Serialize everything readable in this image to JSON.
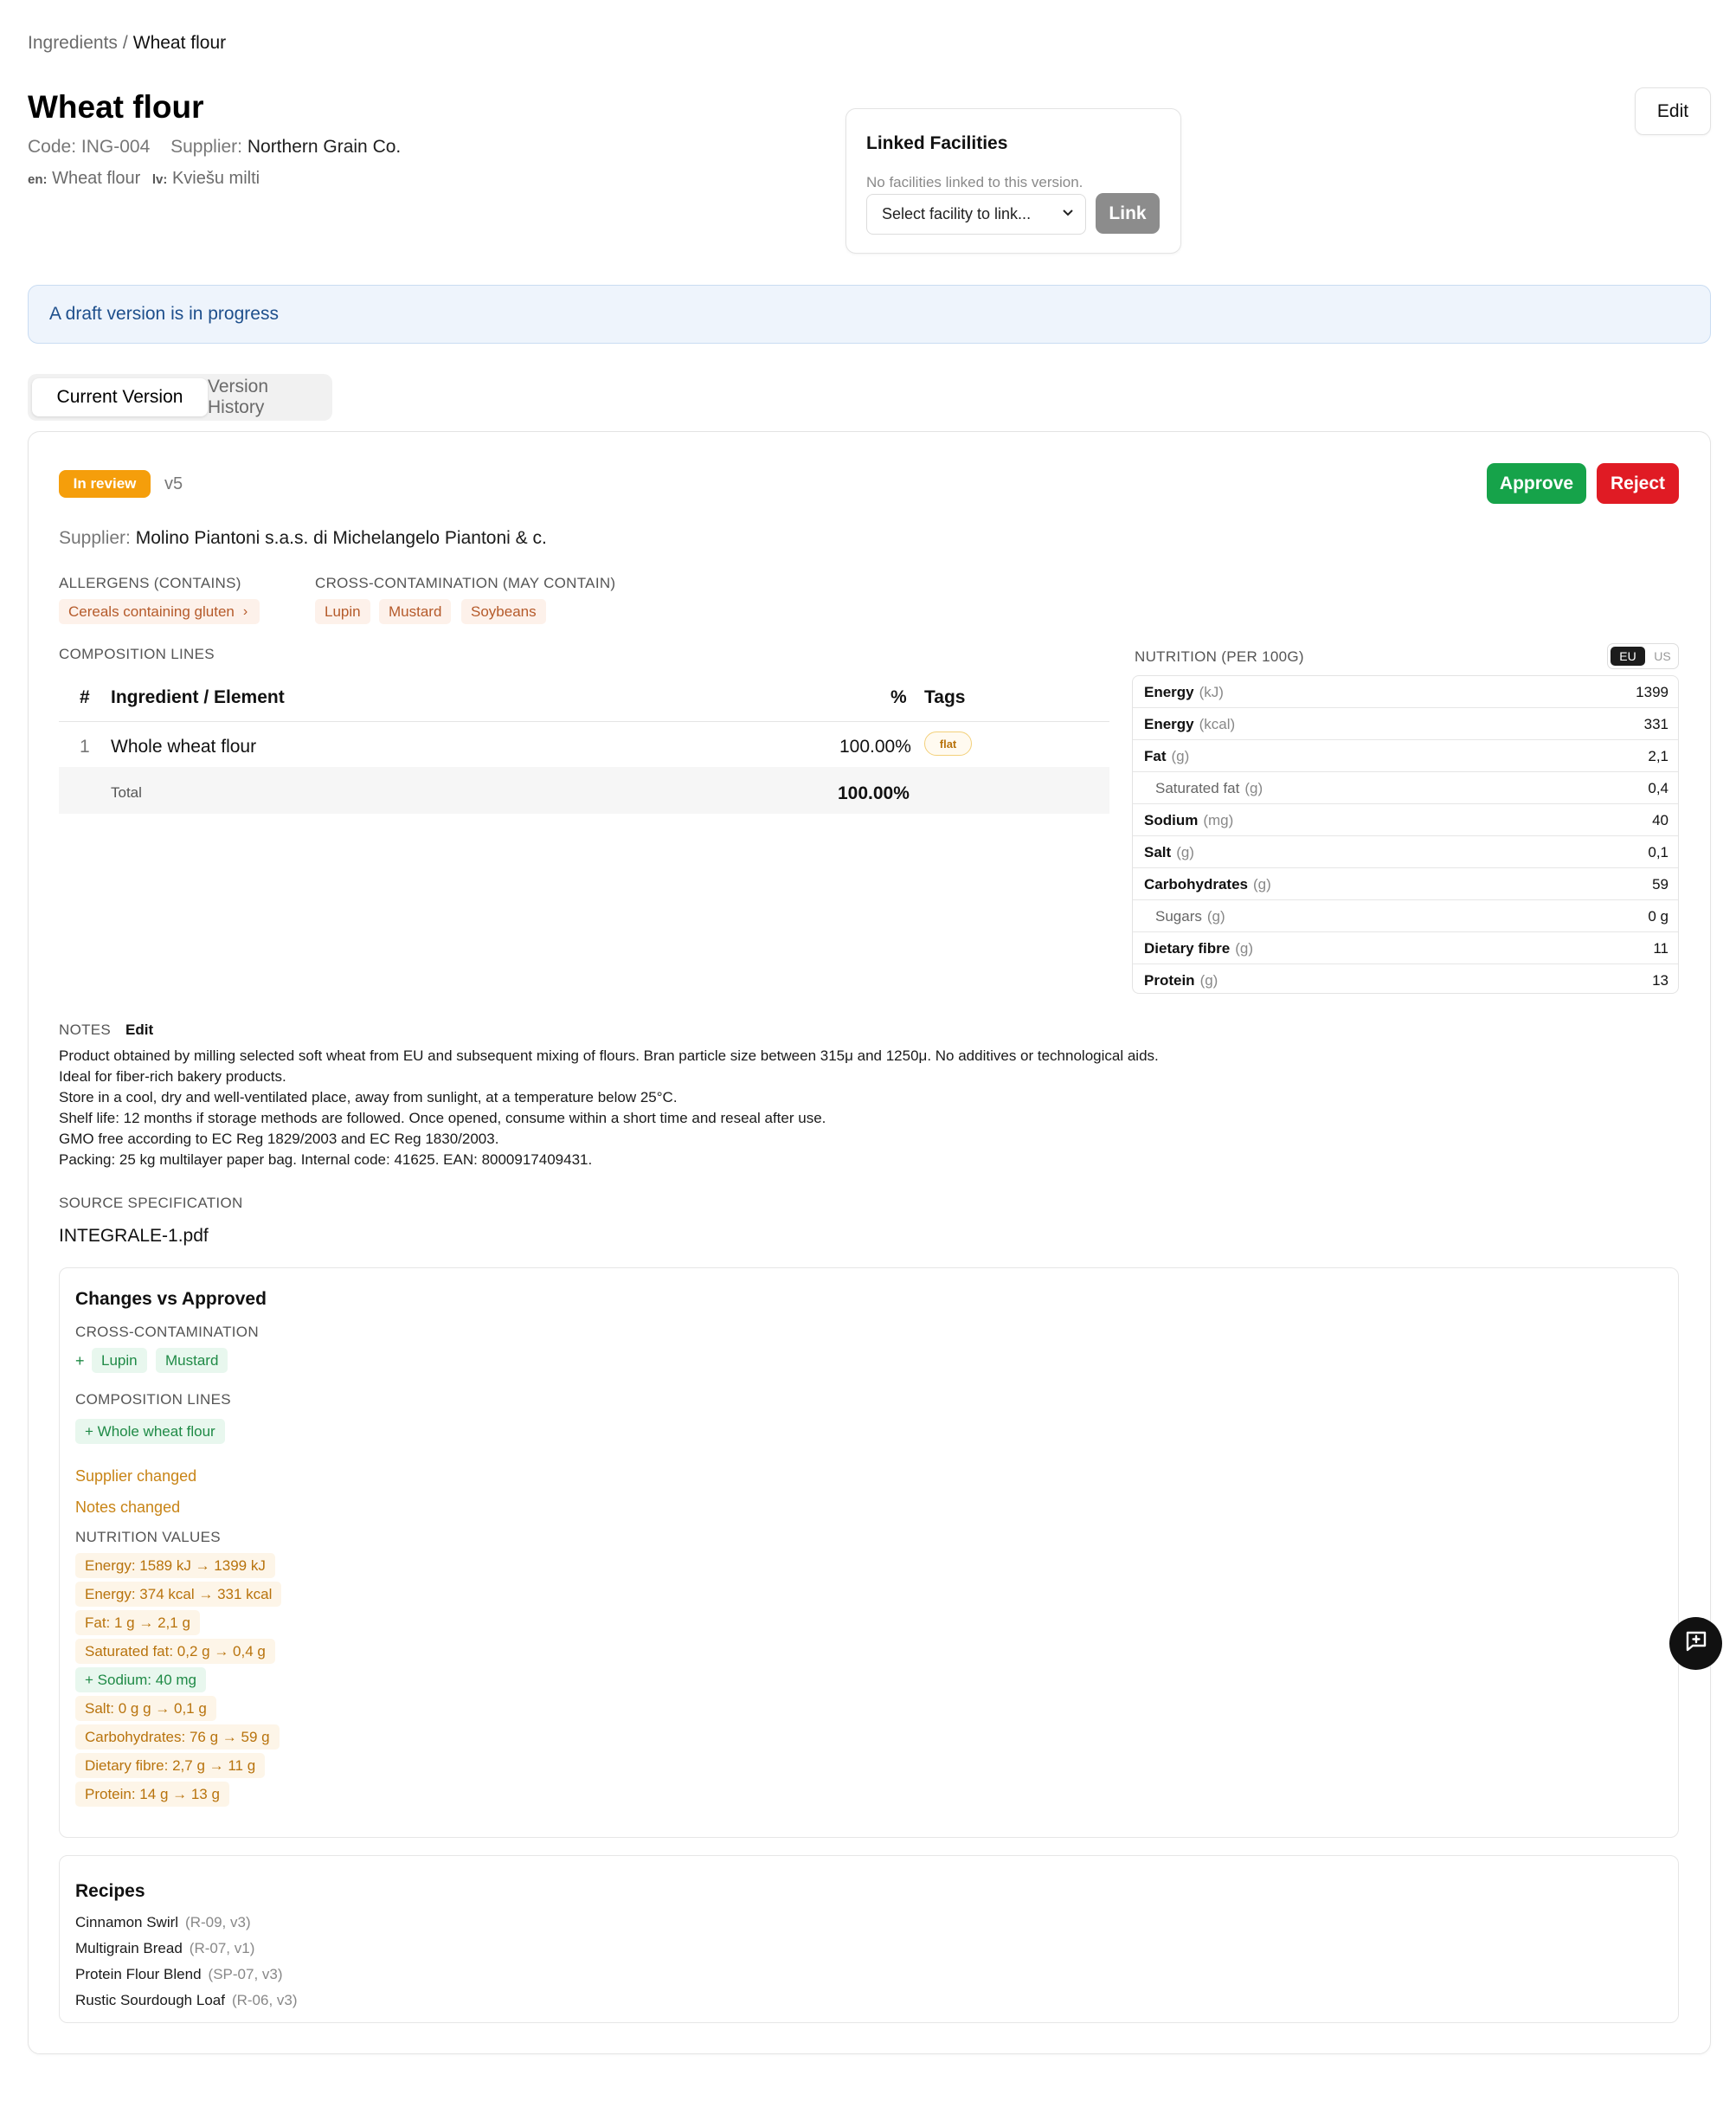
{
  "breadcrumb": {
    "root": "Ingredients",
    "separator": "/",
    "current": "Wheat flour"
  },
  "header": {
    "title": "Wheat flour",
    "code_label": "Code:",
    "code": "ING-004",
    "supplier_label": "Supplier:",
    "supplier": "Northern Grain Co.",
    "translations": [
      {
        "lang": "en:",
        "text": "Wheat flour"
      },
      {
        "lang": "lv:",
        "text": "Kviešu milti"
      }
    ],
    "edit_label": "Edit"
  },
  "facilities": {
    "title": "Linked Facilities",
    "empty_text": "No facilities linked to this version.",
    "select_placeholder": "Select facility to link...",
    "link_label": "Link"
  },
  "draft_banner": "A draft version is in progress",
  "tabs": [
    {
      "label": "Current Version"
    },
    {
      "label": "Version History"
    }
  ],
  "version": {
    "status": "In review",
    "number": "v5",
    "approve_label": "Approve",
    "reject_label": "Reject",
    "supplier_label": "Supplier:",
    "supplier": "Molino Piantoni s.a.s. di Michelangelo Piantoni & c.",
    "allergens_label": "ALLERGENS (CONTAINS)",
    "allergens": [
      "Cereals containing gluten"
    ],
    "cross_label": "CROSS-CONTAMINATION (MAY CONTAIN)",
    "cross": [
      "Lupin",
      "Mustard",
      "Soybeans"
    ]
  },
  "composition": {
    "label": "COMPOSITION LINES",
    "headers": {
      "num": "#",
      "ingredient": "Ingredient / Element",
      "pct": "%",
      "tags": "Tags"
    },
    "rows": [
      {
        "num": "1",
        "ingredient": "Whole wheat flour",
        "pct": "100.00%",
        "tag": "flat"
      }
    ],
    "total_label": "Total",
    "total_value": "100.00%"
  },
  "nutrition": {
    "label": "NUTRITION (PER 100G)",
    "toggle": {
      "eu": "EU",
      "us": "US",
      "selected": "EU"
    },
    "rows": [
      {
        "name": "Energy",
        "unit": "(kJ)",
        "value": "1399",
        "sub": false
      },
      {
        "name": "Energy",
        "unit": "(kcal)",
        "value": "331",
        "sub": false
      },
      {
        "name": "Fat",
        "unit": "(g)",
        "value": "2,1",
        "sub": false
      },
      {
        "name": "Saturated fat",
        "unit": "(g)",
        "value": "0,4",
        "sub": true
      },
      {
        "name": "Sodium",
        "unit": "(mg)",
        "value": "40",
        "sub": false
      },
      {
        "name": "Salt",
        "unit": "(g)",
        "value": "0,1",
        "sub": false
      },
      {
        "name": "Carbohydrates",
        "unit": "(g)",
        "value": "59",
        "sub": false
      },
      {
        "name": "Sugars",
        "unit": "(g)",
        "value": "0 g",
        "sub": true
      },
      {
        "name": "Dietary fibre",
        "unit": "(g)",
        "value": "11",
        "sub": false
      },
      {
        "name": "Protein",
        "unit": "(g)",
        "value": "13",
        "sub": false
      }
    ]
  },
  "notes": {
    "label": "NOTES",
    "edit_label": "Edit",
    "text": "Product obtained by milling selected soft wheat from EU and subsequent mixing of flours. Bran particle size between 315μ and 1250μ. No additives or technological aids.\nIdeal for fiber-rich bakery products.\nStore in a cool, dry and well-ventilated place, away from sunlight, at a temperature below 25°C.\nShelf life: 12 months if storage methods are followed. Once opened, consume within a short time and reseal after use.\nGMO free according to EC Reg 1829/2003 and EC Reg 1830/2003.\nPacking: 25 kg multilayer paper bag. Internal code: 41625. EAN: 8000917409431."
  },
  "source": {
    "label": "SOURCE SPECIFICATION",
    "file": "INTEGRALE-1.pdf"
  },
  "changes": {
    "title": "Changes vs Approved",
    "cross_label": "CROSS-CONTAMINATION",
    "cross_prefix": "+",
    "cross_added": [
      "Lupin",
      "Mustard"
    ],
    "composition_label": "COMPOSITION LINES",
    "composition_added": "+ Whole wheat flour",
    "supplier_changed": "Supplier changed",
    "notes_changed": "Notes changed",
    "nutrition_label": "NUTRITION VALUES",
    "nutrition_changes": [
      {
        "text": "Energy: 1589 kJ → 1399 kJ",
        "kind": "changed"
      },
      {
        "text": "Energy: 374 kcal → 331 kcal",
        "kind": "changed"
      },
      {
        "text": "Fat: 1 g → 2,1 g",
        "kind": "changed"
      },
      {
        "text": "Saturated fat: 0,2 g → 0,4 g",
        "kind": "changed"
      },
      {
        "text": "+ Sodium: 40 mg",
        "kind": "added"
      },
      {
        "text": "Salt: 0 g g → 0,1 g",
        "kind": "changed"
      },
      {
        "text": "Carbohydrates: 76 g → 59 g",
        "kind": "changed"
      },
      {
        "text": "Dietary fibre: 2,7 g → 11 g",
        "kind": "changed"
      },
      {
        "text": "Protein: 14 g → 13 g",
        "kind": "changed"
      }
    ]
  },
  "recipes": {
    "title": "Recipes",
    "items": [
      {
        "name": "Cinnamon Swirl",
        "code": "(R-09, v3)"
      },
      {
        "name": "Multigrain Bread",
        "code": "(R-07, v1)"
      },
      {
        "name": "Protein Flour Blend",
        "code": "(SP-07, v3)"
      },
      {
        "name": "Rustic Sourdough Loaf",
        "code": "(R-06, v3)"
      }
    ]
  },
  "colors": {
    "approve": "#16a34a",
    "reject": "#e01b24",
    "review_badge": "#f59e0b",
    "banner_bg": "#eef4fc",
    "banner_text": "#1e4f8c"
  }
}
